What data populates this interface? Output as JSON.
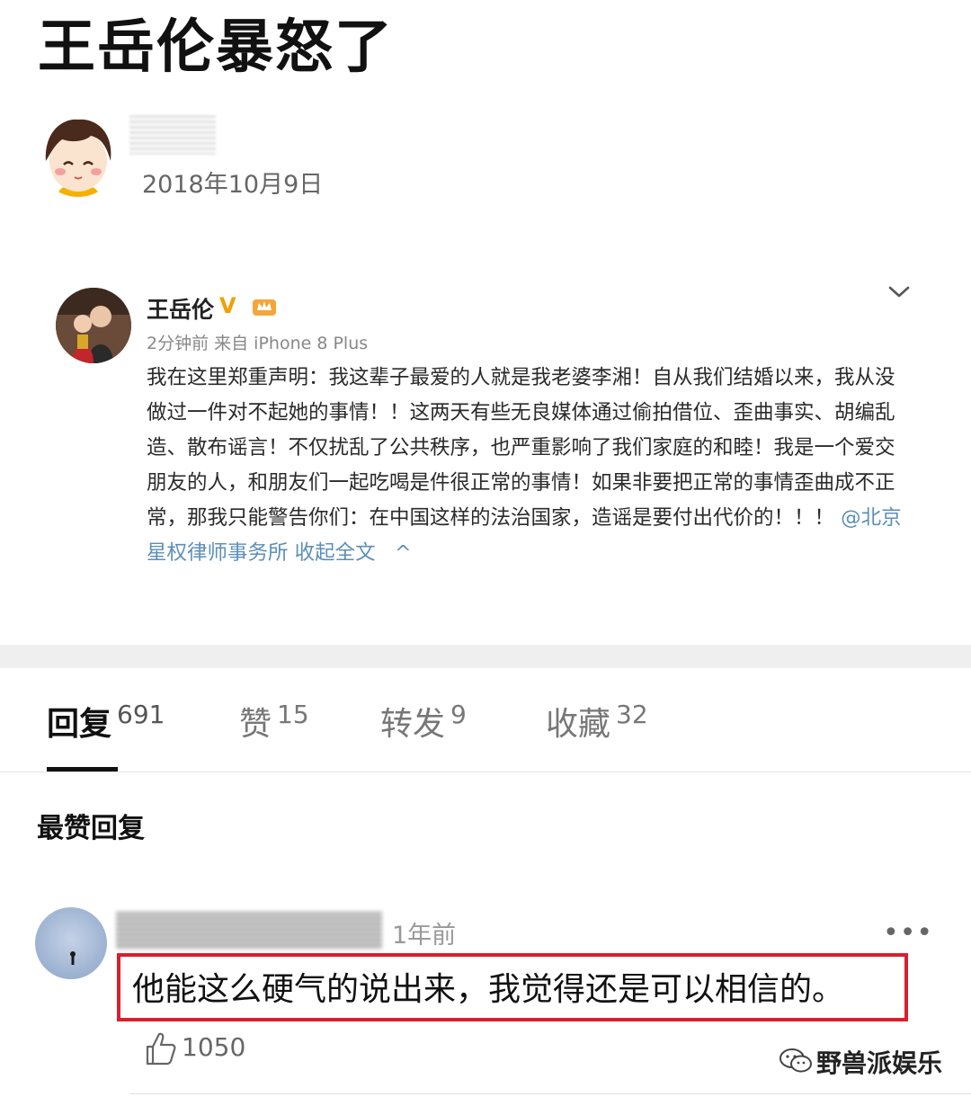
{
  "headline": "王岳伦暴怒了",
  "post_header": {
    "date": "2018年10月9日"
  },
  "weibo": {
    "poster_name": "王岳伦",
    "verified_badge": "V",
    "meta": "2分钟前 来自 iPhone 8 Plus",
    "body": "我在这里郑重声明：我这辈子最爱的人就是我老婆李湘！自从我们结婚以来，我从没做过一件对不起她的事情！！这两天有些无良媒体通过偷拍借位、歪曲事实、胡编乱造、散布谣言！不仅扰乱了公共秩序，也严重影响了我们家庭的和睦！我是一个爱交朋友的人，和朋友们一起吃喝是件很正常的事情！如果非要把正常的事情歪曲成不正常，那我只能警告你们：在中国这样的法治国家，造谣是要付出代价的！！！",
    "mention": "@北京星权律师事务所",
    "collapse_label": "收起全文",
    "collapse_arrow": "^"
  },
  "tabs": [
    {
      "label": "回复",
      "count": "691",
      "active": true
    },
    {
      "label": "赞",
      "count": "15",
      "active": false
    },
    {
      "label": "转发",
      "count": "9",
      "active": false
    },
    {
      "label": "收藏",
      "count": "32",
      "active": false
    }
  ],
  "section_title": "最赞回复",
  "comment": {
    "time": "1年前",
    "more": "•••",
    "text": "他能这么硬气的说出来，我觉得还是可以相信的。",
    "likes": "1050"
  },
  "watermark": "野兽派娱乐",
  "colors": {
    "highlight": "#d6202f",
    "link": "#5c8fb8",
    "badge": "#f0a000"
  }
}
